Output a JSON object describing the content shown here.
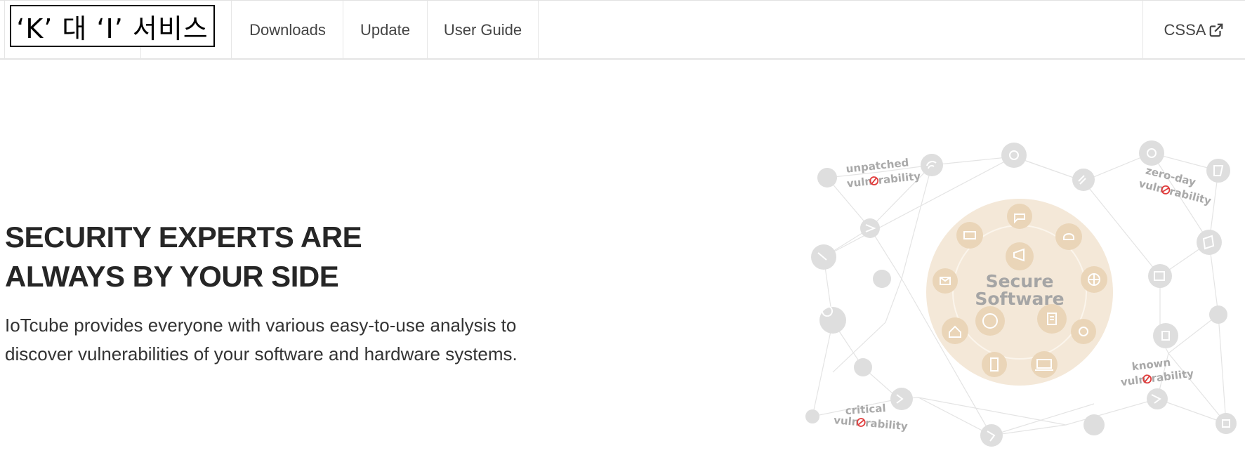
{
  "brand": {
    "text": "‘K’ 대 ‘I’ 서비스"
  },
  "nav": {
    "items": [
      {
        "label": "Downloads"
      },
      {
        "label": "Update"
      },
      {
        "label": "User Guide"
      }
    ],
    "external": {
      "label": "CSSA",
      "icon": "external-link-icon"
    }
  },
  "hero": {
    "title_line1": "SECURITY EXPERTS ARE",
    "title_line2": "ALWAYS BY YOUR SIDE",
    "desc_line1": "IoTcube provides everyone with various easy-to-use analysis to",
    "desc_line2": "discover vulnerabilities of your software and hardware systems."
  },
  "illustration": {
    "center_line1": "Secure",
    "center_line2": "Software",
    "labels": {
      "unpatched": {
        "top": "unpatched",
        "pre": "vuln",
        "post": "rability"
      },
      "zeroday": {
        "top": "zero-day",
        "pre": "vuln",
        "post": "rability"
      },
      "known": {
        "top": "known",
        "pre": "vuln",
        "post": "rability"
      },
      "critical": {
        "top": "critical",
        "pre": "vuln",
        "post": "rability"
      }
    },
    "colors": {
      "circle": "#f3e6d4",
      "node": "#ead6ba",
      "grey": "#d9d9d9",
      "accent": "#e03c3c",
      "text": "#9e9e9e"
    }
  }
}
